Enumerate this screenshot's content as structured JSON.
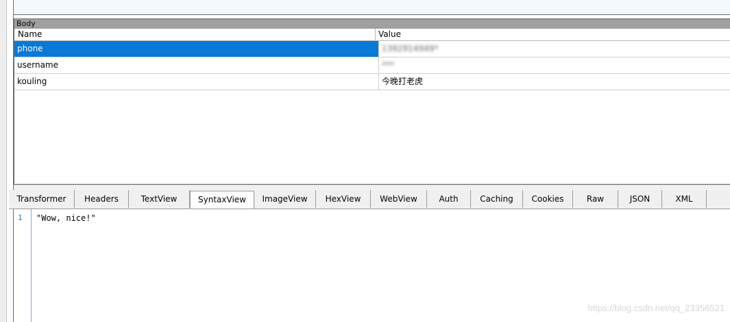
{
  "body_section": {
    "title": "Body",
    "columns": {
      "name": "Name",
      "value": "Value"
    },
    "rows": [
      {
        "name": "phone",
        "value": "1392914949*",
        "selected": true
      },
      {
        "name": "username",
        "value": "*** ",
        "selected": false
      },
      {
        "name": "kouling",
        "value": "今晚打老虎",
        "selected": false
      }
    ]
  },
  "inspector_tabs": [
    {
      "label": "Transformer"
    },
    {
      "label": "Headers"
    },
    {
      "label": "TextView"
    },
    {
      "label": "SyntaxView",
      "active": true
    },
    {
      "label": "ImageView"
    },
    {
      "label": "HexView"
    },
    {
      "label": "WebView"
    },
    {
      "label": "Auth"
    },
    {
      "label": "Caching"
    },
    {
      "label": "Cookies"
    },
    {
      "label": "Raw"
    },
    {
      "label": "JSON"
    },
    {
      "label": "XML"
    }
  ],
  "editor": {
    "line_number": "1",
    "code": "\"Wow, nice!\""
  },
  "watermark": "https://blog.csdn.net/qq_23356521",
  "colors": {
    "selection": "#0a78d7",
    "section_header": "#a0a0a0",
    "line_number": "#2b7bbf"
  }
}
